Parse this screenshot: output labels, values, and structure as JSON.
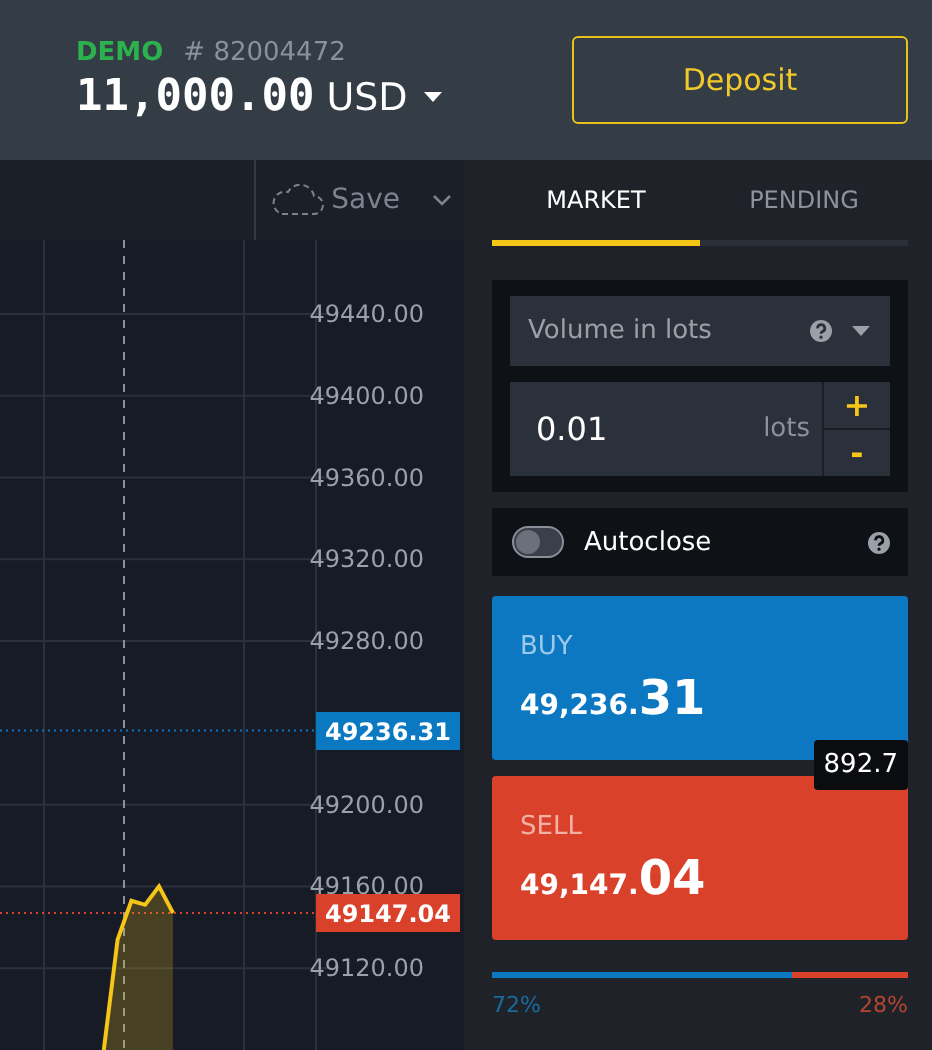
{
  "account": {
    "mode": "DEMO",
    "number": "# 82004472",
    "balance": "11,000.00",
    "currency": "USD"
  },
  "deposit_button": "Deposit",
  "chart_toolbar": {
    "save": "Save"
  },
  "chart": {
    "chart_data": {
      "type": "area",
      "grid": true,
      "categories": [
        null,
        null,
        null,
        null,
        null,
        null,
        null,
        null,
        null,
        null,
        null,
        null,
        null,
        null,
        null,
        null,
        null,
        null,
        null,
        null,
        null,
        null,
        null,
        null
      ],
      "series": [
        {
          "color": "#f5c518",
          "values": [
            null,
            null,
            null,
            null,
            null,
            null,
            null,
            49080,
            49134,
            49153,
            49151,
            49160,
            49147,
            null,
            null,
            null,
            null,
            null,
            null,
            null,
            null,
            null,
            null,
            null
          ]
        }
      ],
      "ylim": [
        49080,
        49440
      ],
      "yticks": [
        {
          "value": 49440,
          "label": "49440.00"
        },
        {
          "value": 49400,
          "label": "49400.00"
        },
        {
          "value": 49360,
          "label": "49360.00"
        },
        {
          "value": 49320,
          "label": "49320.00"
        },
        {
          "value": 49280,
          "label": "49280.00"
        },
        {
          "value": 49200,
          "label": "49200.00"
        },
        {
          "value": 49160,
          "label": "49160.00"
        },
        {
          "value": 49120,
          "label": "49120.00"
        }
      ],
      "ref_lines": [
        {
          "axis": "y",
          "value": 49236.31,
          "label": "49236.31",
          "color": "#0b79c2"
        },
        {
          "axis": "y",
          "value": 49147.04,
          "label": "49147.04",
          "color": "#d9412a"
        }
      ]
    }
  },
  "tabs": [
    {
      "label": "MARKET",
      "selected": true
    },
    {
      "label": "PENDING",
      "selected": false
    }
  ],
  "volume": {
    "mode": "Volume in lots",
    "value": "0.01",
    "unit": "lots",
    "plus": "+",
    "minus": "-"
  },
  "autoclose": {
    "label": "Autoclose",
    "on": false
  },
  "buy": {
    "label": "BUY",
    "price_main": "49,236.",
    "price_pips": "31"
  },
  "sell": {
    "label": "SELL",
    "price_main": "49,147.",
    "price_pips": "04"
  },
  "spread": "892.7",
  "sentiment": {
    "level": 0.72,
    "buy": "72%",
    "sell": "28%"
  }
}
